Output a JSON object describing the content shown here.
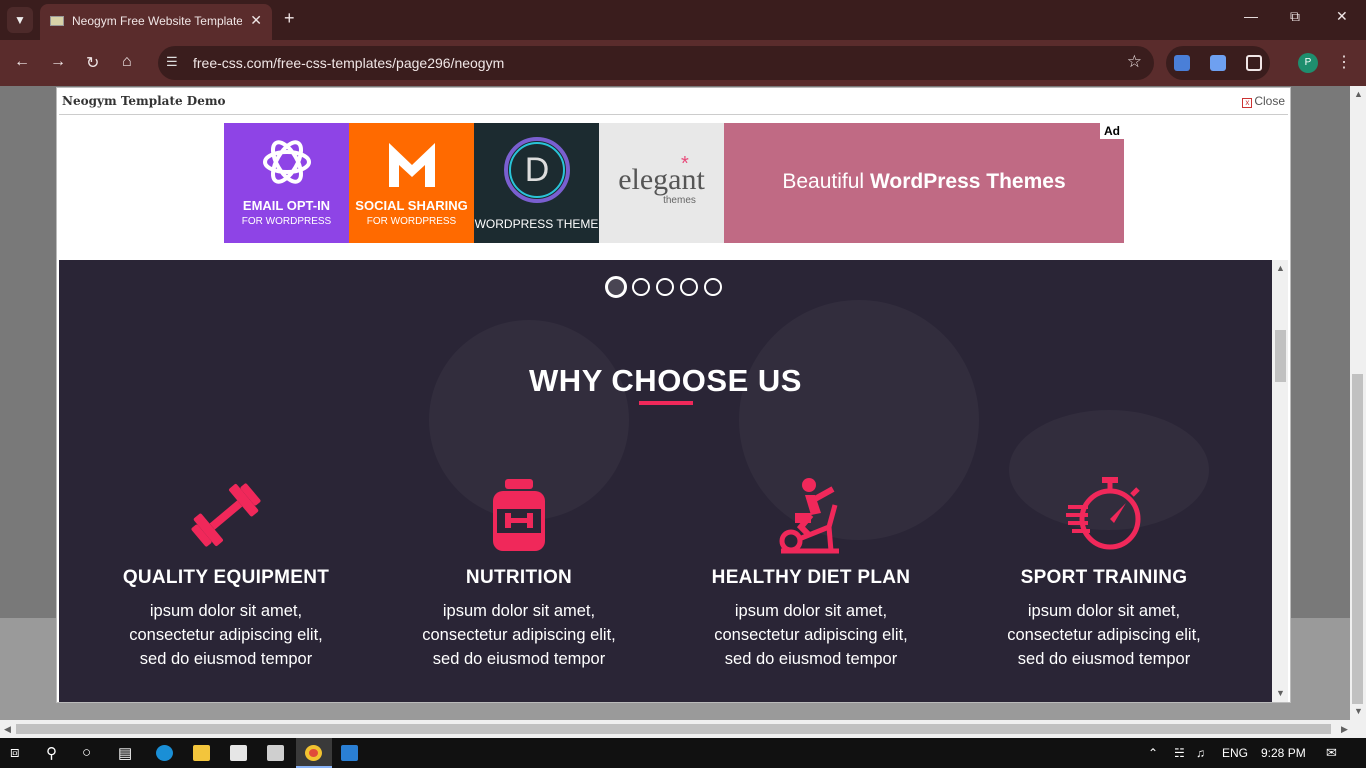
{
  "browser": {
    "tab_title": "Neogym Free Website Template",
    "new_tab_icon": "+",
    "url": "free-css.com/free-css-templates/page296/neogym",
    "profile_initial": "P"
  },
  "modal": {
    "title": "Neogym Template Demo",
    "close_label": "Close"
  },
  "ad": {
    "tiles": [
      {
        "line1": "EMAIL OPT-IN",
        "line2": "FOR WORDPRESS",
        "color": "#8e44e6"
      },
      {
        "line1": "SOCIAL SHARING",
        "line2": "FOR WORDPRESS",
        "color": "#ff6a00"
      },
      {
        "line1": "WORDPRESS THEME",
        "line2": "",
        "color": "#1c2b30"
      },
      {
        "line1": "elegant",
        "line2": "themes",
        "color": "#e8e8e8"
      }
    ],
    "banner_text_light": "Beautiful ",
    "banner_text_bold": "WordPress Themes",
    "badge": "Ad"
  },
  "page": {
    "heading": "WHY CHOOSE US",
    "slider_dots": 5,
    "slider_active_index": 0,
    "accent": "#f0285a",
    "features": [
      {
        "icon": "dumbbell-icon",
        "title": "QUALITY EQUIPMENT",
        "line1": "ipsum dolor sit amet,",
        "line2": "consectetur adipiscing elit,",
        "line3": "sed do eiusmod tempor"
      },
      {
        "icon": "supplement-jar-icon",
        "title": "NUTRITION",
        "line1": "ipsum dolor sit amet,",
        "line2": "consectetur adipiscing elit,",
        "line3": "sed do eiusmod tempor"
      },
      {
        "icon": "exercise-bike-icon",
        "title": "HEALTHY DIET PLAN",
        "line1": "ipsum dolor sit amet,",
        "line2": "consectetur adipiscing elit,",
        "line3": "sed do eiusmod tempor"
      },
      {
        "icon": "stopwatch-icon",
        "title": "SPORT TRAINING",
        "line1": "ipsum dolor sit amet,",
        "line2": "consectetur adipiscing elit,",
        "line3": "sed do eiusmod tempor"
      }
    ]
  },
  "taskbar": {
    "language": "ENG",
    "time": "9:28 PM"
  }
}
